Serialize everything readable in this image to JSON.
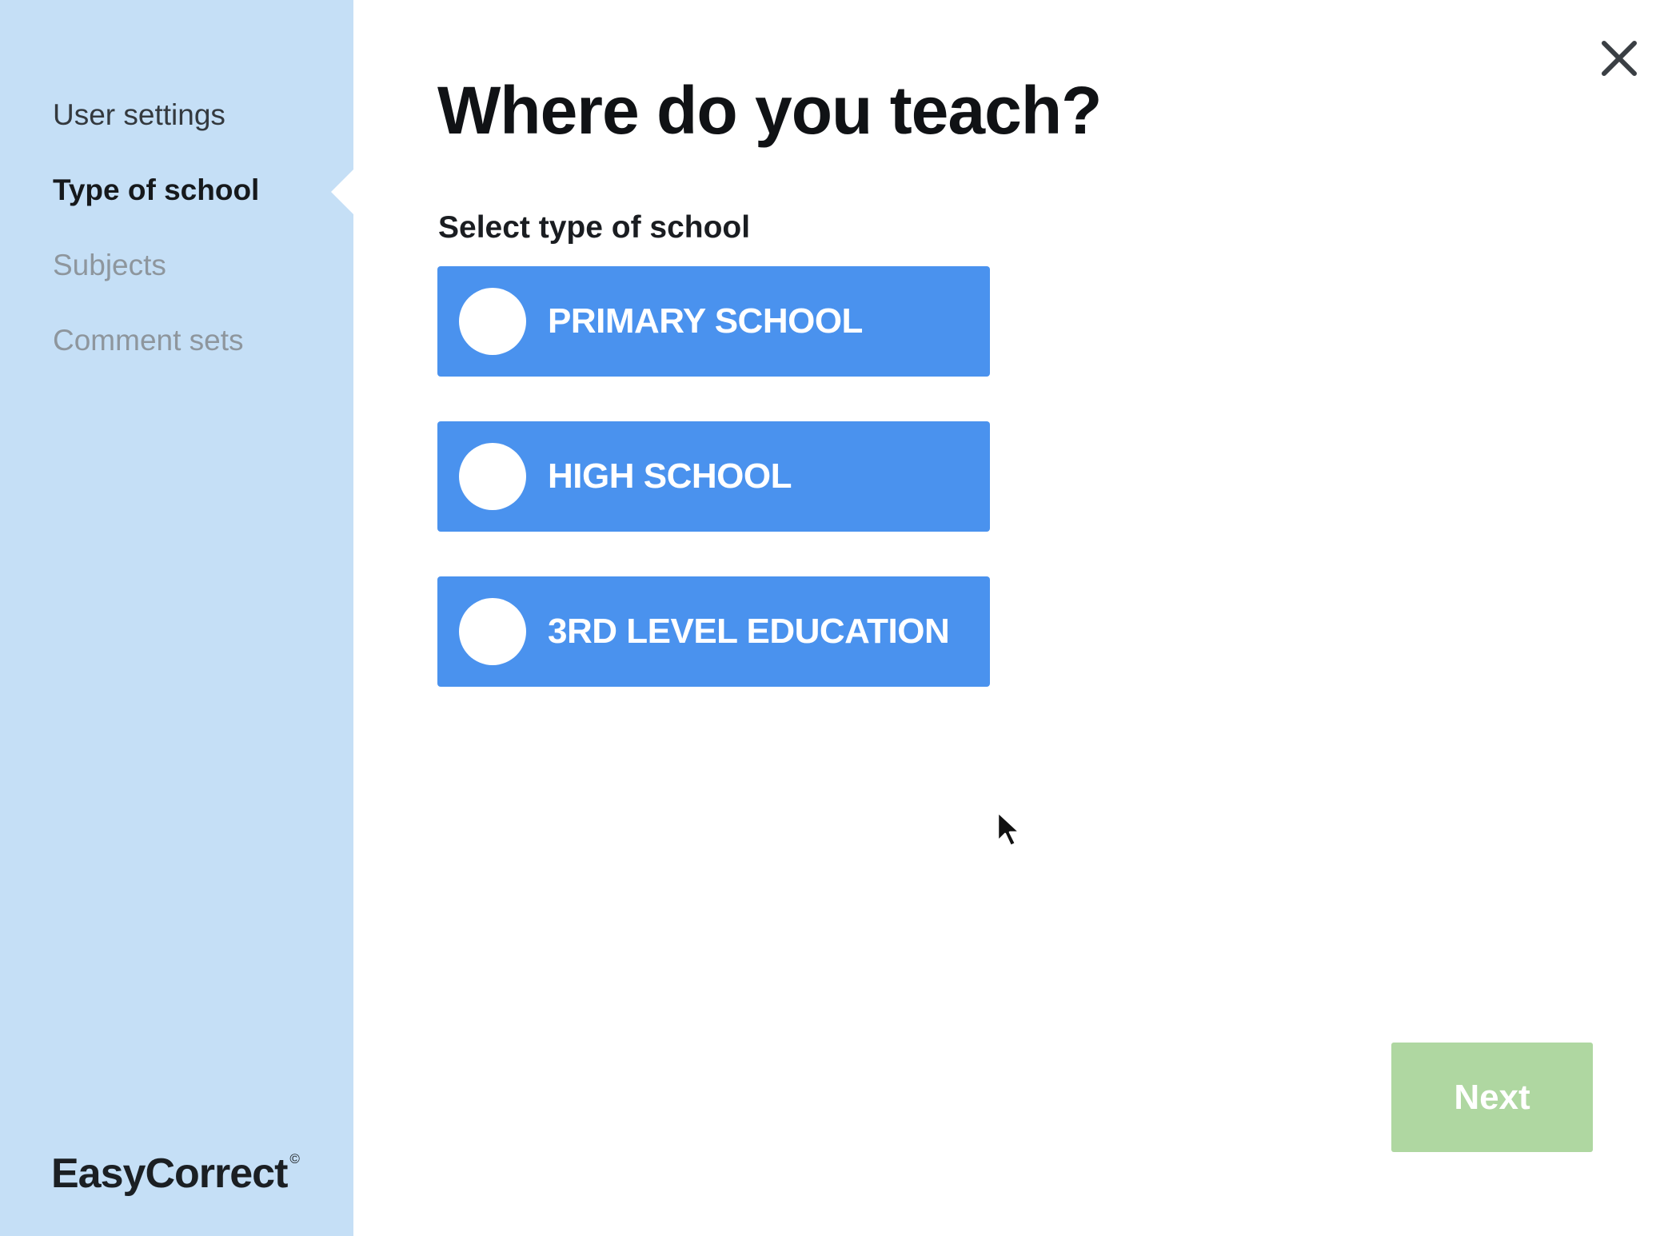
{
  "sidebar": {
    "nav_items": [
      {
        "label": "User settings",
        "state": "completed"
      },
      {
        "label": "Type of school",
        "state": "active"
      },
      {
        "label": "Subjects",
        "state": "upcoming"
      },
      {
        "label": "Comment sets",
        "state": "upcoming"
      }
    ],
    "brand": "EasyCorrect",
    "brand_mark": "©",
    "background_color": "#c5dff6"
  },
  "header": {
    "close_icon": "close-icon"
  },
  "main": {
    "title": "Where do you teach?",
    "subtitle": "Select type of school",
    "options": [
      {
        "label": "PRIMARY SCHOOL",
        "selected": false
      },
      {
        "label": "HIGH SCHOOL",
        "selected": false
      },
      {
        "label": "3RD LEVEL EDUCATION",
        "selected": false
      }
    ],
    "option_color": "#4a92ee"
  },
  "footer": {
    "next_label": "Next",
    "next_enabled": false,
    "next_color": "#afd7a1"
  }
}
